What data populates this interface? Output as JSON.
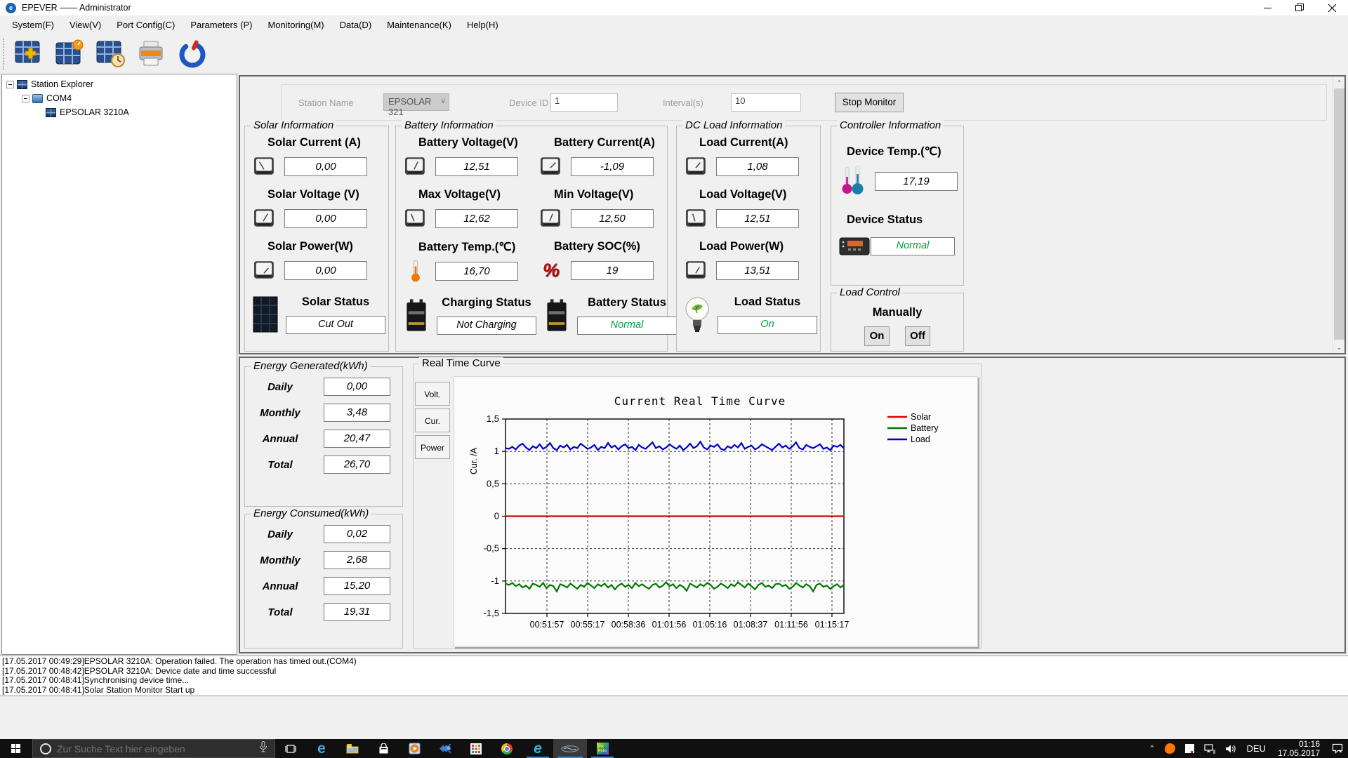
{
  "window": {
    "title": "EPEVER —— Administrator"
  },
  "menu": {
    "items": [
      "System(F)",
      "View(V)",
      "Port Config(C)",
      "Parameters (P)",
      "Monitoring(M)",
      "Data(D)",
      "Maintenance(K)",
      "Help(H)"
    ]
  },
  "tree": {
    "root": "Station Explorer",
    "com": "COM4",
    "device": "EPSOLAR 3210A"
  },
  "monitor": {
    "station_name_label": "Station Name",
    "station_name": "EPSOLAR 321",
    "device_id_label": "Device ID",
    "device_id": "1",
    "interval_label": "Interval(s)",
    "interval": "10",
    "stop_button": "Stop Monitor"
  },
  "solar": {
    "title": "Solar Information",
    "rows": [
      {
        "label": "Solar Current (A)",
        "value": "0,00"
      },
      {
        "label": "Solar Voltage (V)",
        "value": "0,00"
      },
      {
        "label": "Solar Power(W)",
        "value": "0,00"
      }
    ],
    "status_label": "Solar Status",
    "status": "Cut Out"
  },
  "battery": {
    "title": "Battery Information",
    "rows": [
      {
        "label": "Battery Voltage(V)",
        "value": "12,51"
      },
      {
        "label": "Battery Current(A)",
        "value": "-1,09"
      },
      {
        "label": "Max Voltage(V)",
        "value": "12,62"
      },
      {
        "label": "Min Voltage(V)",
        "value": "12,50"
      },
      {
        "label": "Battery Temp.(℃)",
        "value": "16,70"
      },
      {
        "label": "Battery SOC(%)",
        "value": "19"
      }
    ],
    "charging_status_label": "Charging Status",
    "charging_status": "Not Charging",
    "battery_status_label": "Battery Status",
    "battery_status": "Normal"
  },
  "dc_load": {
    "title": "DC Load Information",
    "rows": [
      {
        "label": "Load Current(A)",
        "value": "1,08"
      },
      {
        "label": "Load Voltage(V)",
        "value": "12,51"
      },
      {
        "label": "Load Power(W)",
        "value": "13,51"
      }
    ],
    "status_label": "Load Status",
    "status": "On"
  },
  "controller": {
    "title": "Controller Information",
    "temp_label": "Device Temp.(℃)",
    "temp": "17,19",
    "status_label": "Device Status",
    "status": "Normal"
  },
  "load_control": {
    "title": "Load Control",
    "subtitle": "Manually",
    "on": "On",
    "off": "Off"
  },
  "energy_generated": {
    "title": "Energy Generated(kWh)",
    "rows": [
      {
        "label": "Daily",
        "value": "0,00"
      },
      {
        "label": "Monthly",
        "value": "3,48"
      },
      {
        "label": "Annual",
        "value": "20,47"
      },
      {
        "label": "Total",
        "value": "26,70"
      }
    ]
  },
  "energy_consumed": {
    "title": "Energy Consumed(kWh)",
    "rows": [
      {
        "label": "Daily",
        "value": "0,02"
      },
      {
        "label": "Monthly",
        "value": "2,68"
      },
      {
        "label": "Annual",
        "value": "15,20"
      },
      {
        "label": "Total",
        "value": "19,31"
      }
    ]
  },
  "curve": {
    "group_title": "Real Time Curve",
    "tabs": [
      "Volt.",
      "Cur.",
      "Power"
    ]
  },
  "chart_data": {
    "type": "line",
    "title": "Current Real Time Curve",
    "ylabel": "Cur. /A",
    "ylim": [
      -1.5,
      1.5
    ],
    "ytick_step": 0.5,
    "ytick_labels": [
      "1,5",
      "1",
      "0,5",
      "0",
      "-0,5",
      "-1",
      "-1,5"
    ],
    "xtick_labels": [
      "00:51:57",
      "00:55:17",
      "00:58:36",
      "01:01:56",
      "01:05:16",
      "01:08:37",
      "01:11:56",
      "01:15:17"
    ],
    "grid": "dashed",
    "legend_position": "outside-right-top",
    "series": [
      {
        "name": "Solar",
        "color": "#dd0000",
        "values": [
          0,
          0
        ]
      },
      {
        "name": "Battery",
        "color": "#007700",
        "values": [
          -1.04,
          -1.06,
          -1.03,
          -1.08,
          -1.05,
          -1.1,
          -1.07,
          -1.12,
          -1.04,
          -1.06,
          -1.09,
          -1.03,
          -1.11,
          -1.06,
          -1.08,
          -1.16,
          -1.05,
          -1.07,
          -1.1,
          -1.04,
          -1.08,
          -1.12,
          -1.06,
          -1.09,
          -1.03,
          -1.07,
          -1.11,
          -1.05,
          -1.08,
          -1.04,
          -1.1,
          -1.06,
          -1.13,
          -1.07,
          -1.04,
          -1.09,
          -1.06,
          -1.11,
          -1.03,
          -1.08,
          -1.05,
          -1.09,
          -1.12,
          -1.06,
          -1.04,
          -1.1,
          -1.07,
          -1.02,
          -1.08,
          -1.05,
          -1.11,
          -1.06,
          -1.09,
          -1.15,
          -1.04,
          -1.07,
          -1.1,
          -1.05,
          -1.08,
          -1.03,
          -1.06,
          -1.12,
          -1.09,
          -1.04,
          -1.07,
          -1.11,
          -1.05,
          -1.08,
          -1.02,
          -1.06,
          -1.1,
          -1.04,
          -1.08,
          -1.13,
          -1.06,
          -1.03,
          -1.09,
          -1.07,
          -1.11,
          -1.05,
          -1.04,
          -1.08,
          -1.06,
          -1.12,
          -1.09,
          -1.03,
          -1.07,
          -1.1,
          -1.05,
          -1.08,
          -1.16,
          -1.06,
          -1.04,
          -1.09,
          -1.07,
          -1.12,
          -1.08,
          -1.05,
          -1.1,
          -1.06
        ]
      },
      {
        "name": "Load",
        "color": "#0000cc",
        "values": [
          1.05,
          1.04,
          1.07,
          1.03,
          1.09,
          1.12,
          1.06,
          1.02,
          1.08,
          1.05,
          1.11,
          1.04,
          1.07,
          1.13,
          1.05,
          1.02,
          1.09,
          1.06,
          1.1,
          1.03,
          1.07,
          1.05,
          1.12,
          1.08,
          1.04,
          1.06,
          1.1,
          1.02,
          1.07,
          1.05,
          1.13,
          1.06,
          1.09,
          1.03,
          1.08,
          1.11,
          1.05,
          1.07,
          1.02,
          1.1,
          1.06,
          1.04,
          1.09,
          1.14,
          1.05,
          1.08,
          1.03,
          1.06,
          1.11,
          1.07,
          1.04,
          1.09,
          1.02,
          1.06,
          1.12,
          1.05,
          1.08,
          1.15,
          1.06,
          1.03,
          1.09,
          1.07,
          1.11,
          1.04,
          1.02,
          1.08,
          1.05,
          1.1,
          1.06,
          1.13,
          1.04,
          1.07,
          1.09,
          1.03,
          1.06,
          1.11,
          1.08,
          1.05,
          1.02,
          1.07,
          1.12,
          1.06,
          1.09,
          1.04,
          1.08,
          1.14,
          1.05,
          1.03,
          1.1,
          1.07,
          1.05,
          1.08,
          1.11,
          1.04,
          1.06,
          1.02,
          1.09,
          1.07,
          1.1,
          1.05
        ]
      }
    ]
  },
  "log": {
    "lines": [
      "[17.05.2017 00:49:29]EPSOLAR 3210A: Operation failed. The operation has timed out.(COM4)",
      "[17.05.2017 00:48:42]EPSOLAR 3210A: Device date and time successful",
      "[17.05.2017 00:48:41]Synchronising device time...",
      "[17.05.2017 00:48:41]Solar Station Monitor Start up"
    ]
  },
  "taskbar": {
    "search_placeholder": "Zur Suche Text hier eingeben",
    "language": "DEU",
    "time": "01:16",
    "date": "17.05.2017"
  },
  "colors": {
    "status_green": "#00a33c",
    "taskbar_indicator": "#2f8fd1"
  }
}
